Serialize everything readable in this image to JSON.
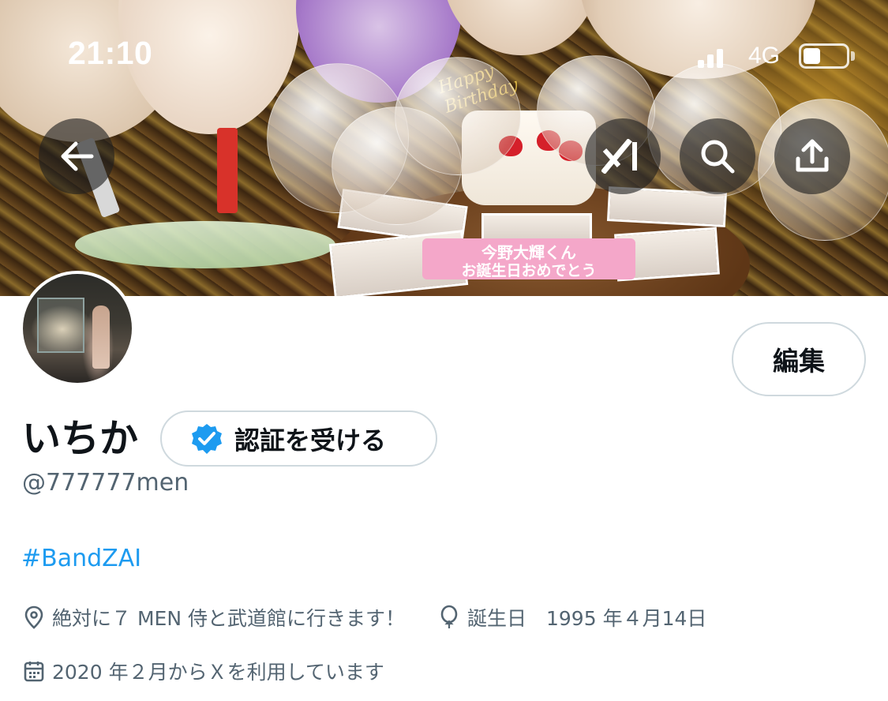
{
  "status_bar": {
    "time": "21:10",
    "network": "4G",
    "battery_level": 0.4,
    "signal_bars": 3
  },
  "banner": {
    "cake_plate_text_line1": "今野大輝くん",
    "cake_plate_text_line2": "お誕生日おめでとう",
    "cake_topper_text": "Happy Birthday"
  },
  "toolbar": {
    "back_icon": "arrow-left-icon",
    "grok_icon": "grok-icon",
    "search_icon": "search-icon",
    "share_icon": "share-icon"
  },
  "profile": {
    "display_name": "いちか",
    "handle": "@777777men",
    "edit_label": "編集",
    "verify_label": "認証を受ける",
    "bio_hashtag": "#BandZAI",
    "location": "絶対に７ MEN 侍と武道館に行きます！",
    "birthday": "誕生日　1995 年４月14日",
    "joined": "2020 年２月からＸを利用しています"
  },
  "colors": {
    "accent": "#1d9bf0",
    "secondary_text": "#536471",
    "primary_text": "#0f1419",
    "button_border": "#cfd9de"
  }
}
